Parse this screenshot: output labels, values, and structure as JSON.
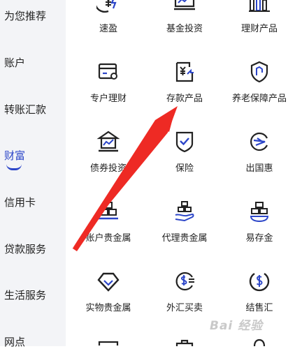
{
  "sidebar": {
    "items": [
      {
        "label": "为您推荐"
      },
      {
        "label": "账户"
      },
      {
        "label": "转账汇款"
      },
      {
        "label": "财富"
      },
      {
        "label": "信用卡"
      },
      {
        "label": "贷款服务"
      },
      {
        "label": "生活服务"
      },
      {
        "label": "网点"
      }
    ],
    "active": "财富"
  },
  "grid": {
    "items": [
      {
        "label": "速盈",
        "icon": "yen-lightning-icon"
      },
      {
        "label": "基金投资",
        "icon": "fund-chart-icon"
      },
      {
        "label": "理财产品",
        "icon": "bar-chart-icon"
      },
      {
        "label": "专户理财",
        "icon": "card-wallet-icon"
      },
      {
        "label": "存款产品",
        "icon": "yen-document-icon"
      },
      {
        "label": "养老保障产品",
        "icon": "pension-shield-icon"
      },
      {
        "label": "债券投资",
        "icon": "bond-building-icon"
      },
      {
        "label": "保险",
        "icon": "insurance-shield-icon"
      },
      {
        "label": "出国惠",
        "icon": "plane-circle-icon"
      },
      {
        "label": "账户贵金属",
        "icon": "gold-bars-icon"
      },
      {
        "label": "代理贵金属",
        "icon": "gold-hand-icon"
      },
      {
        "label": "易存金",
        "icon": "gold-stack-icon"
      },
      {
        "label": "实物贵金属",
        "icon": "diamond-icon"
      },
      {
        "label": "外汇买卖",
        "icon": "dollar-exchange-icon"
      },
      {
        "label": "结售汇",
        "icon": "dollar-circle-icon"
      }
    ]
  },
  "watermark": {
    "text": "Bai 经验"
  },
  "colors": {
    "accent": "#2b45c8",
    "arrow": "#ee2a24",
    "sidebar_bg": "#f3f4f7"
  }
}
